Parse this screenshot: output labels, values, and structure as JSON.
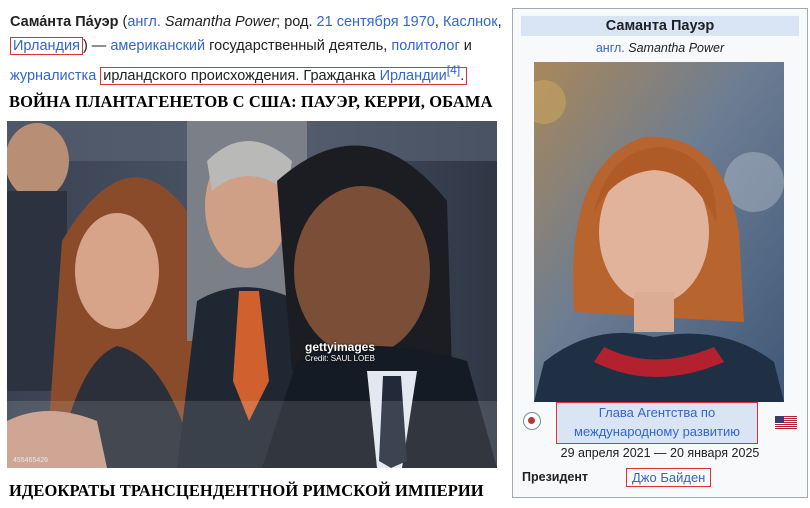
{
  "intro": {
    "name": "Сама́нта Па́уэр",
    "open_paren": " (",
    "lang": "англ.",
    "original": "Samantha Power",
    "born_prefix": "; род. ",
    "birth_date": "21 сентября 1970",
    "comma": ", ",
    "birth_city": "Каслнок",
    "birth_country": "Ирландия",
    "close_paren": ") — ",
    "nationality": "американский",
    "role_text": " государственный деятель, ",
    "occupation1": "политолог",
    "and": " и ",
    "occupation2": "журналистка",
    "origin": "ирландского происхождения",
    "citizen_prefix": ". Гражданка ",
    "citizenship": "Ирландии",
    "ref": "[4]",
    "end": "."
  },
  "heading_top": "ВОЙНА ПЛАНТАГЕНЕТОВ С США: ПАУЭР, КЕРРИ, ОБАМА",
  "photo": {
    "watermark_brand": "gettyimages",
    "watermark_credit": "Credit: SAUL LOEB",
    "image_id": "455465426"
  },
  "heading_bottom": "ИДЕОКРАТЫ ТРАНСЦЕНДЕНТНОЙ РИМСКОЙ ИМПЕРИИ",
  "infobox": {
    "title": "Саманта Пауэр",
    "lang": "англ.",
    "original": "Samantha Power",
    "role_line1": "Глава Агентства по",
    "role_line2": "международному развитию",
    "dates": "29 апреля 2021 — 20 января 2025",
    "president_label": "Президент",
    "president": "Джо Байден"
  }
}
